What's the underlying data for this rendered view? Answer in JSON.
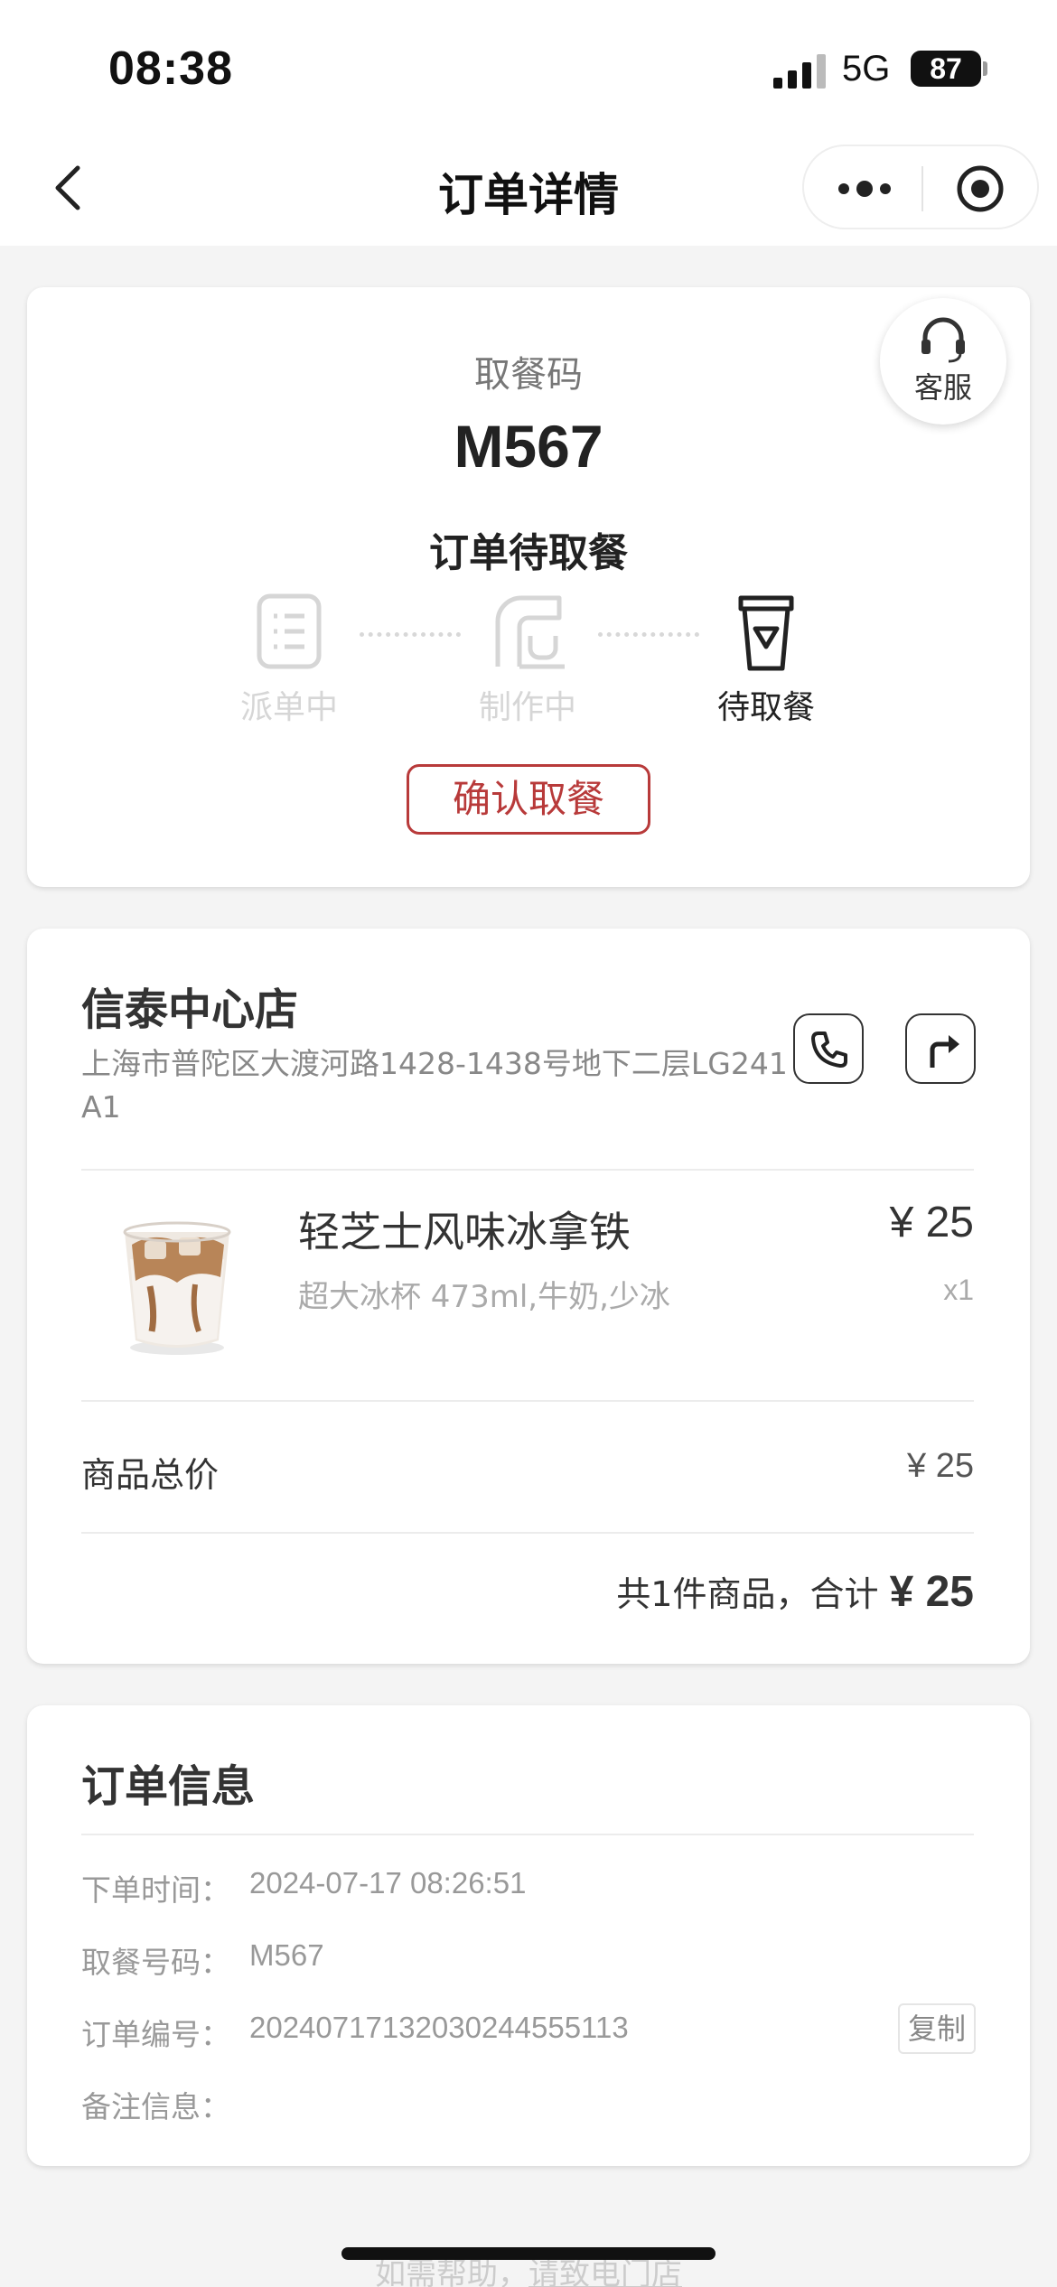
{
  "status_bar": {
    "time": "08:38",
    "network": "5G",
    "battery": "87"
  },
  "nav": {
    "title": "订单详情",
    "more_icon": "more-dots-icon",
    "close_icon": "target-circle-icon"
  },
  "pickup": {
    "label": "取餐码",
    "code": "M567",
    "status": "订单待取餐",
    "steps": [
      {
        "label": "派单中",
        "icon": "order-list-icon",
        "active": false
      },
      {
        "label": "制作中",
        "icon": "coffee-machine-icon",
        "active": false
      },
      {
        "label": "待取餐",
        "icon": "cup-icon",
        "active": true
      }
    ],
    "confirm_label": "确认取餐",
    "service_label": "客服"
  },
  "store": {
    "name": "信泰中心店",
    "address": "上海市普陀区大渡河路1428-1438号地下二层LG241A1",
    "call_icon": "phone-icon",
    "nav_icon": "directions-icon"
  },
  "product": {
    "name": "轻芝士风味冰拿铁",
    "spec": "超大冰杯 473ml,牛奶,少冰",
    "price": "¥ 25",
    "qty": "x1"
  },
  "summary": {
    "subtotal_label": "商品总价",
    "subtotal_value": "¥ 25",
    "total_prefix": "共1件商品，合计",
    "total_value": "¥ 25"
  },
  "order_info": {
    "title": "订单信息",
    "rows": [
      {
        "key": "下单时间：",
        "value": "2024-07-17 08:26:51"
      },
      {
        "key": "取餐号码：",
        "value": "M567"
      },
      {
        "key": "订单编号：",
        "value": "20240717132030244555113"
      },
      {
        "key": "备注信息：",
        "value": ""
      }
    ],
    "copy_label": "复制"
  },
  "footer": {
    "prefix": "如需帮助，",
    "link": "请致电门店"
  },
  "colors": {
    "accent": "#b83a3a",
    "background": "#f4f4f4"
  }
}
